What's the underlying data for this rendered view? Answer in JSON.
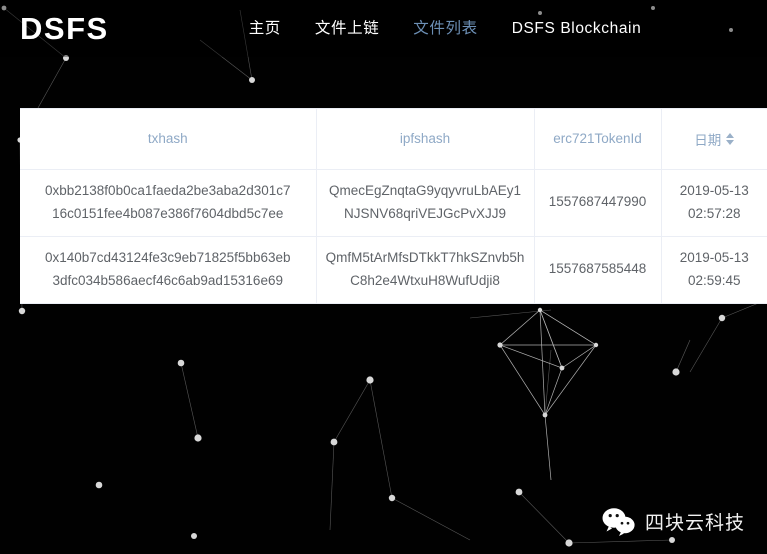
{
  "brand": {
    "name": "DSFS"
  },
  "nav": {
    "items": [
      {
        "label": "主页",
        "active": false,
        "name": "nav-item-home"
      },
      {
        "label": "文件上链",
        "active": false,
        "name": "nav-item-upload"
      },
      {
        "label": "文件列表",
        "active": true,
        "name": "nav-item-file-list"
      },
      {
        "label": "DSFS Blockchain",
        "active": false,
        "name": "nav-item-blockchain"
      }
    ]
  },
  "table": {
    "columns": [
      {
        "label": "txhash",
        "sortable": false
      },
      {
        "label": "ipfshash",
        "sortable": false
      },
      {
        "label": "erc721TokenId",
        "sortable": false
      },
      {
        "label": "日期",
        "sortable": true
      }
    ],
    "rows": [
      {
        "txhash_line1": "0xbb2138f0b0ca1faeda2be3aba2d301c7",
        "txhash_line2": "16c0151fee4b087e386f7604dbd5c7ee",
        "ipfshash_line1": "QmecEgZnqtaG9yqyvruLbAEy1",
        "ipfshash_line2": "NJSNV68qriVEJGcPvXJJ9",
        "erc721TokenId": "1557687447990",
        "date_line1": "2019-05-13",
        "date_line2": "02:57:28"
      },
      {
        "txhash_line1": "0x140b7cd43124fe3c9eb71825f5bb63eb",
        "txhash_line2": "3dfc034b586aecf46c6ab9ad15316e69",
        "ipfshash_line1": "QmfM5tArMfsDTkkT7hkSZnvb5h",
        "ipfshash_line2": "C8h2e4WtxuH8WufUdji8",
        "erc721TokenId": "1557687585448",
        "date_line1": "2019-05-13",
        "date_line2": "02:59:45"
      }
    ]
  },
  "watermark": {
    "icon": "wechat-icon",
    "text": "四块云科技"
  },
  "colors": {
    "background": "#010101",
    "card": "#ffffff",
    "header_text": "#8fa9c6",
    "body_text": "#5f6368",
    "nav_active": "#6c8fb5",
    "nav_text": "#ffffff",
    "border": "#ebeef5"
  }
}
